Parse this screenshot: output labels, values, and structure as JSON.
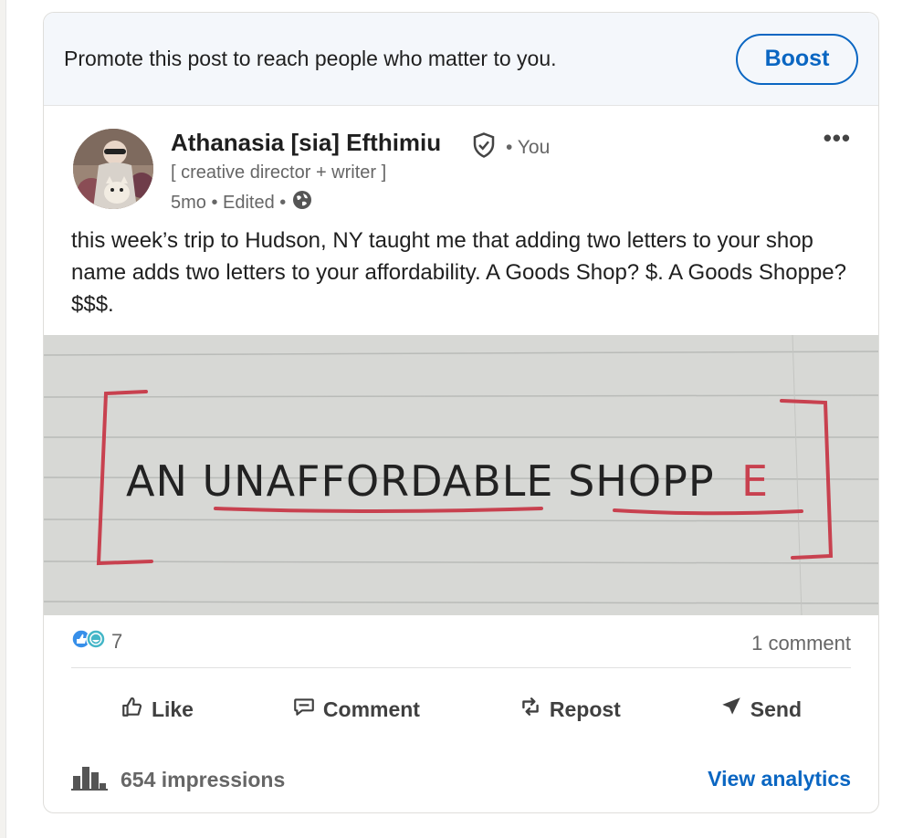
{
  "promo": {
    "text": "Promote this post to reach people who matter to you.",
    "boost_label": "Boost"
  },
  "author": {
    "name": "Athanasia [sia] Efthimiu",
    "you_label": "• You",
    "headline": "[ creative director + writer ]",
    "meta": "5mo • Edited •"
  },
  "post": {
    "text": "this week’s trip to Hudson, NY taught me that adding two letters to your shop name adds two letters to your affordability. A Goods Shop? $. A Goods Shoppe? $$$.",
    "image_text_main": "AN UNAFFORDABLE SHOPP",
    "image_text_end": "E"
  },
  "stats": {
    "reaction_count": "7",
    "comments": "1 comment"
  },
  "actions": {
    "like": "Like",
    "comment": "Comment",
    "repost": "Repost",
    "send": "Send"
  },
  "footer": {
    "impressions": "654 impressions",
    "analytics": "View analytics"
  },
  "colors": {
    "brand_blue": "#0a66c2",
    "ink_red": "#c4434f"
  }
}
